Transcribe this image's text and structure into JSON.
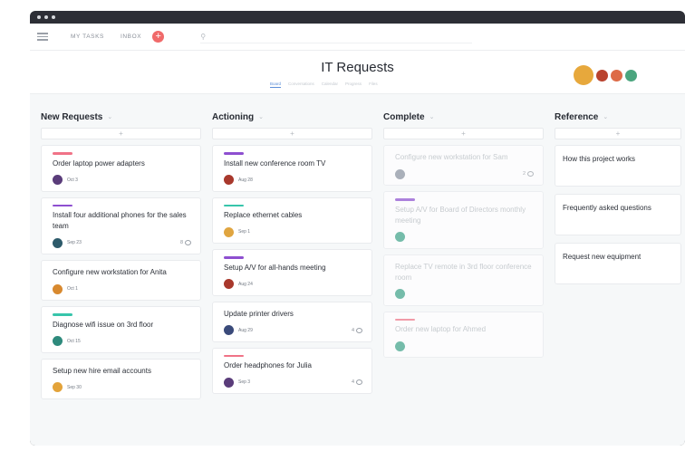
{
  "topbar": {
    "my_tasks": "MY TASKS",
    "inbox": "INBOX",
    "add": "+",
    "search_placeholder": "⚲"
  },
  "project": {
    "title": "IT Requests",
    "views": [
      "Board",
      "Conversations",
      "Calendar",
      "Progress",
      "Files"
    ],
    "active_view": "Board"
  },
  "members": [
    "#e7a83c",
    "#b9432f",
    "#dd6b47",
    "#4ba57e"
  ],
  "columns": [
    {
      "name": "New Requests",
      "cards": [
        {
          "tag": "#f07387",
          "title": "Order laptop power adapters",
          "avatar": "#5a3c7a",
          "date": "Oct 3",
          "comments": ""
        },
        {
          "tag": "#8e4fd0",
          "title": "Install four additional phones for the sales team",
          "avatar": "#2d5a6a",
          "date": "Sep 23",
          "comments": "8"
        },
        {
          "tag": "",
          "title": "Configure new workstation for Anita",
          "avatar": "#d8892f",
          "date": "Oct 1",
          "comments": ""
        },
        {
          "tag": "#37c5ab",
          "title": "Diagnose wifi issue on 3rd floor",
          "avatar": "#2e8a7c",
          "date": "Oct 15",
          "comments": ""
        },
        {
          "tag": "",
          "title": "Setup new hire email accounts",
          "avatar": "#e3a33a",
          "date": "Sep 30",
          "comments": ""
        }
      ]
    },
    {
      "name": "Actioning",
      "cards": [
        {
          "tag": "#8e4fd0",
          "title": "Install new conference room TV",
          "avatar": "#a8382c",
          "date": "Aug 28",
          "comments": ""
        },
        {
          "tag": "#37c5ab",
          "title": "Replace ethernet cables",
          "avatar": "#e0a540",
          "date": "Sep 1",
          "comments": ""
        },
        {
          "tag": "#8e4fd0",
          "title": "Setup A/V for all-hands meeting",
          "avatar": "#a8382c",
          "date": "Aug 24",
          "comments": ""
        },
        {
          "tag": "",
          "title": "Update printer drivers",
          "avatar": "#3a4a7a",
          "date": "Aug 29",
          "comments": "4"
        },
        {
          "tag": "#f07387",
          "title": "Order headphones for Julia",
          "avatar": "#5a3c7a",
          "date": "Sep 3",
          "comments": "4"
        }
      ]
    },
    {
      "name": "Complete",
      "cards": [
        {
          "tag": "",
          "title": "Configure new workstation for Sam",
          "avatar": "#8a93a0",
          "date": "",
          "comments": "2"
        },
        {
          "tag": "#8e4fd0",
          "title": "Setup A/V for Board of Directors monthly meeting",
          "avatar": "#3fa48a",
          "date": "",
          "comments": ""
        },
        {
          "tag": "",
          "title": "Replace TV remote in 3rd floor conference room",
          "avatar": "#3fa48a",
          "date": "",
          "comments": ""
        },
        {
          "tag": "#f07387",
          "title": "Order new laptop for Ahmed",
          "avatar": "#3fa48a",
          "date": "",
          "comments": ""
        }
      ]
    },
    {
      "name": "Reference",
      "cards": [
        {
          "title": "How this project works"
        },
        {
          "title": "Frequently asked questions"
        },
        {
          "title": "Request new equipment"
        }
      ]
    }
  ]
}
